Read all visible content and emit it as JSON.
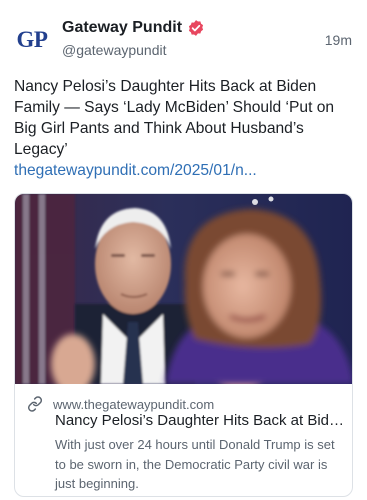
{
  "author": {
    "avatar_text": "GP",
    "display_name": "Gateway Pundit",
    "handle": "@gatewaypundit",
    "verified_icon": "verified-badge-icon",
    "timestamp": "19m"
  },
  "post": {
    "text": "Nancy Pelosi’s Daughter Hits Back at Biden Family — Says ‘Lady McBiden’ Should ‘Put on Big Girl Pants and Think About Husband’s Legacy’",
    "link_text": "thegatewaypundit.com/2025/01/n..."
  },
  "card": {
    "image_alt": "Photo of Joe Biden and Nancy Pelosi",
    "domain": "www.thegatewaypundit.com",
    "title": "Nancy Pelosi’s Daughter Hits Back at Biden Family — Says ‘Lady McBiden’ Should ‘Put on Big Girl Pants and Think About Husband’s Legacy’",
    "description": "With just over 24 hours until Donald Trump is set to be sworn in, the Democratic Party civil war is just beginning.",
    "link_icon": "link-icon"
  },
  "colors": {
    "link": "#2f6fb5",
    "brand": "#23408e",
    "verified": "#e8475f"
  }
}
